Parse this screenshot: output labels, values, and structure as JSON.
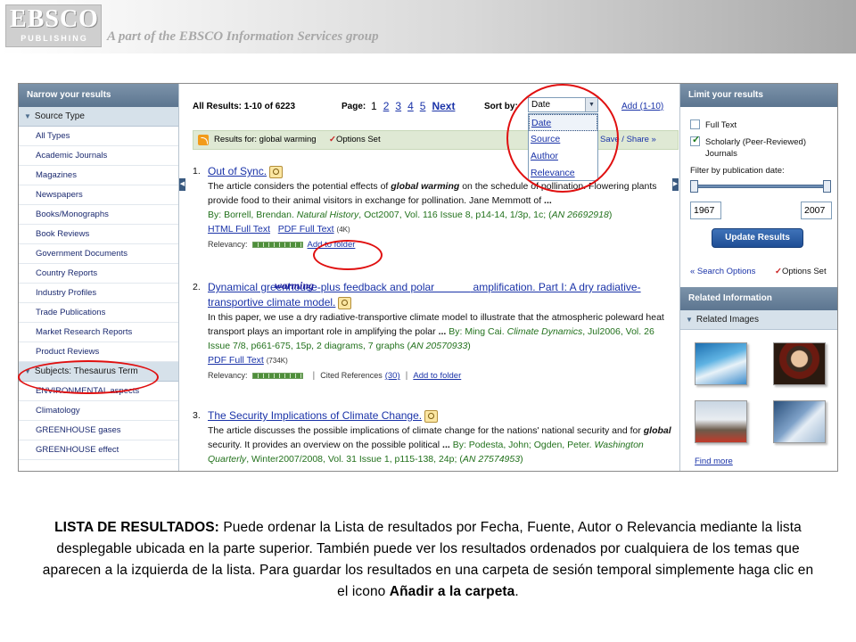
{
  "header": {
    "logo_main": "EBSCO",
    "logo_sub": "PUBLISHING",
    "tagline": "A part of the EBSCO Information Services group"
  },
  "left_panel": {
    "title": "Narrow your results",
    "source_type": {
      "label": "Source Type",
      "items": [
        "All Types",
        "Academic Journals",
        "Magazines",
        "Newspapers",
        "Books/Monographs",
        "Book Reviews",
        "Government Documents",
        "Country Reports",
        "Industry Profiles",
        "Trade Publications",
        "Market Research Reports",
        "Product Reviews"
      ]
    },
    "subjects": {
      "label": "Subjects: Thesaurus Term",
      "items": [
        "ENVIRONMENTAL aspects",
        "Climatology",
        "GREENHOUSE gases",
        "GREENHOUSE effect"
      ]
    }
  },
  "toolbar": {
    "all_results": "All Results: 1-10 of 6223",
    "page_label": "Page:",
    "pages": [
      "1",
      "2",
      "3",
      "4",
      "5"
    ],
    "next": "Next",
    "sort_label": "Sort by:",
    "sort_value": "Date",
    "sort_options": [
      "Date",
      "Source",
      "Author",
      "Relevance"
    ],
    "add_range": "Add (1-10)"
  },
  "results_bar": {
    "results_for": "Results for: global warming",
    "options_set": "Options Set",
    "save_share": "Save / Share »"
  },
  "results": [
    {
      "num": "1.",
      "title": "Out of Sync.",
      "abstract_pre": "The article considers the potential effects of ",
      "abstract_bold": "global warming",
      "abstract_post": " on the schedule of pollination. Flowering plants provide food to their animal visitors in exchange for pollination. Jane Memmott of ",
      "abstract_ellipsis": "...",
      "cite_by": "By: Borrell, Brendan. ",
      "cite_source": "Natural History",
      "cite_rest": ", Oct2007, Vol. 116 Issue 8, p14-14, 1/3p, 1c; (",
      "cite_an": "AN 26692918",
      "cite_end": ")",
      "links": [
        "HTML Full Text",
        "PDF Full Text"
      ],
      "pdf_size": "(4K)",
      "relevancy": "Relevancy:",
      "add_folder": "Add to folder"
    },
    {
      "num": "2.",
      "title_pre": "Dynamical greenhouse-plus feedback and polar ",
      "title_post": " amplification. Part I: A dry radiative-transportive climate model.",
      "handwritten": "warming",
      "abstract": "In this paper, we use a dry radiative-transportive climate model to illustrate that the atmospheric poleward heat transport plays an important role in amplifying the polar ",
      "abstract_ellipsis": "...",
      "cite_by": " By: Ming Cai. ",
      "cite_source": "Climate Dynamics",
      "cite_rest": ", Jul2006, Vol. 26 Issue 7/8, p661-675, 15p, 2 diagrams, 7 graphs (",
      "cite_an": "AN 20570933",
      "cite_end": ")",
      "links": [
        "PDF Full Text"
      ],
      "pdf_size": "(734K)",
      "relevancy": "Relevancy:",
      "cited_refs": "Cited References",
      "cited_count": "(30)",
      "add_folder": "Add to folder"
    },
    {
      "num": "3.",
      "title": "The Security Implications of Climate Change.",
      "abstract_a": "The article discusses the possible implications of climate change for the nations' national security and for ",
      "abstract_bold": "global",
      "abstract_b": " security. It provides an overview on the possible political ",
      "abstract_ellipsis": "...",
      "cite_by": " By: Podesta, John; Ogden, Peter. ",
      "cite_source": "Washington Quarterly",
      "cite_rest": ", Winter2007/2008, Vol. 31 Issue 1, p115-138, 24p; (",
      "cite_an": "AN 27574953",
      "cite_end": ")"
    }
  ],
  "right_panel": {
    "title": "Limit your results",
    "full_text": "Full Text",
    "scholarly_1": "Scholarly (Peer-Reviewed)",
    "scholarly_2": "Journals",
    "filter_label": "Filter by publication date:",
    "year_from": "1967",
    "year_to": "2007",
    "update_button": "Update Results",
    "search_options": "« Search Options",
    "options_set": "Options Set",
    "related_title": "Related Information",
    "related_images": "Related Images",
    "find_more": "Find more"
  },
  "caption": {
    "lead": "LISTA DE RESULTADOS:",
    "text": " Puede ordenar la Lista de resultados por Fecha, Fuente, Autor o Relevancia mediante la lista desplegable ubicada en la parte superior. También puede ver los resultados ordenados por cualquiera de los temas que aparecen a la izquierda de la lista. Para guardar los resultados en una carpeta de sesión temporal simplemente haga clic en el icono ",
    "bold_end": "Añadir a la carpeta",
    "period": "."
  },
  "colors": {
    "link_blue": "#1a33a8",
    "citation_green": "#22711c",
    "panel_header": "#5c7590",
    "annotation_red": "#e01010"
  },
  "icons": [
    "rss-icon",
    "magnifier-icon",
    "checkmark-icon",
    "triangle-down-icon",
    "scroll-left-arrow-icon",
    "scroll-right-arrow-icon"
  ]
}
